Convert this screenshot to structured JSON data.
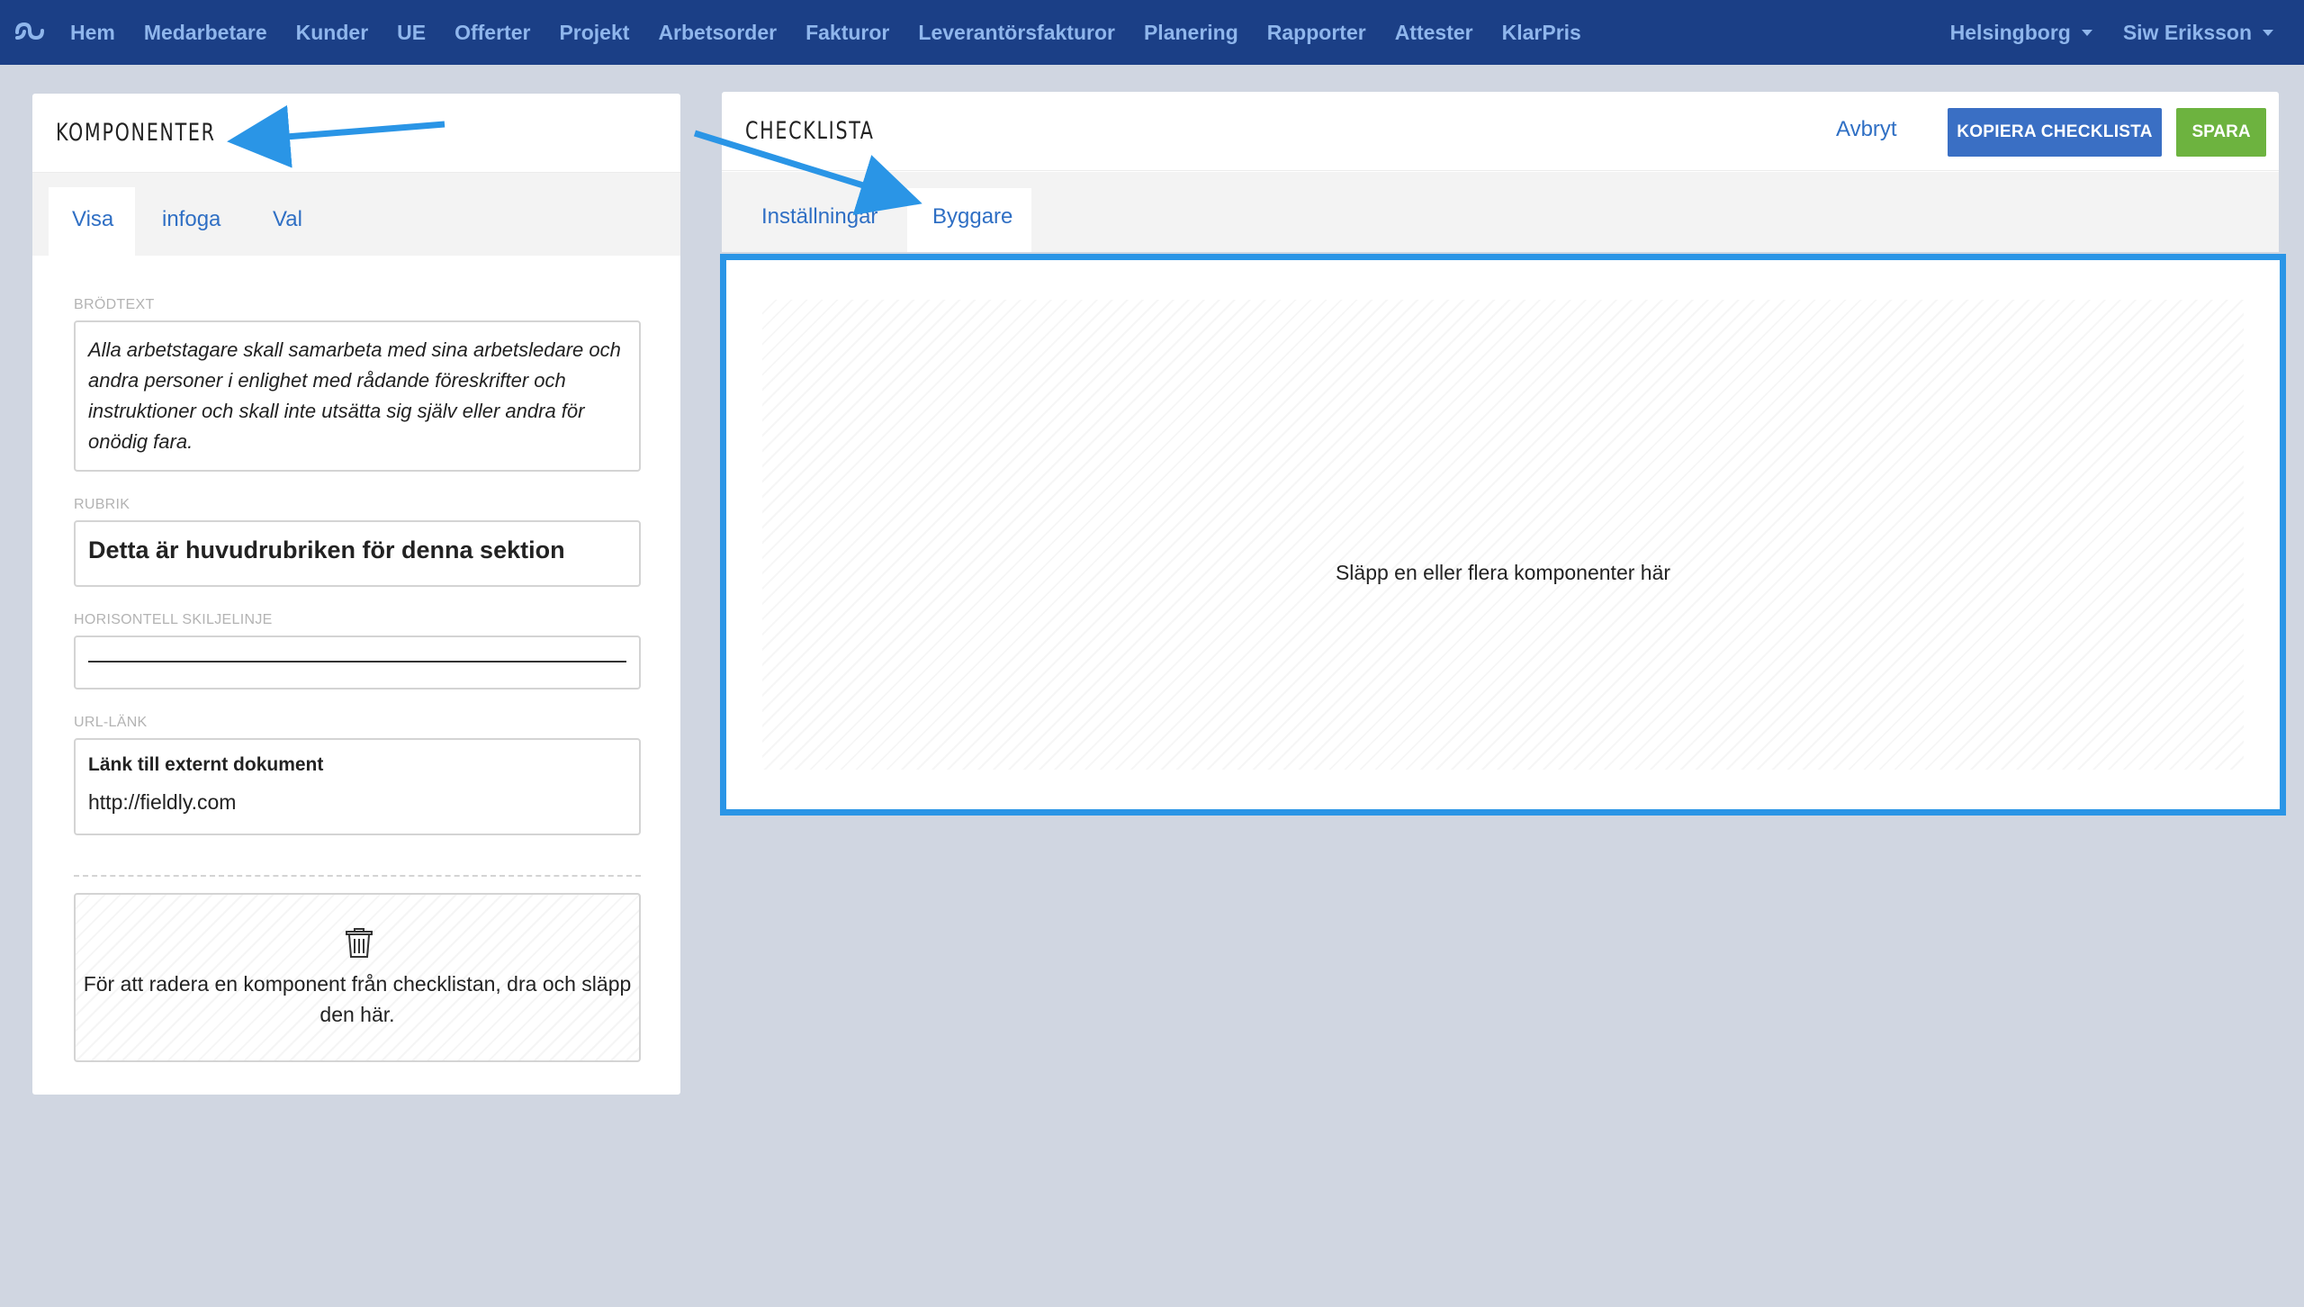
{
  "nav": {
    "items": [
      "Hem",
      "Medarbetare",
      "Kunder",
      "UE",
      "Offerter",
      "Projekt",
      "Arbetsorder",
      "Fakturor",
      "Leverantörsfakturor",
      "Planering",
      "Rapporter",
      "Attester",
      "KlarPris"
    ],
    "location": "Helsingborg",
    "user": "Siw Eriksson"
  },
  "components_panel": {
    "title": "KOMPONENTER",
    "tabs": [
      "Visa",
      "infoga",
      "Val"
    ],
    "active_tab": "Visa",
    "fields": {
      "body_label": "BRÖDTEXT",
      "body_text": "Alla arbetstagare skall samarbeta med sina arbetsledare och andra personer i enlighet med rådande föreskrifter och instruktioner och skall inte utsätta sig själv eller andra för onödig fara.",
      "heading_label": "RUBRIK",
      "heading_text": "Detta är huvudrubriken för denna sektion",
      "divider_label": "HORISONTELL SKILJELINJE",
      "url_label": "URL-LÄNK",
      "url_title": "Länk till externt dokument",
      "url_value": "http://fieldly.com"
    },
    "trash_text": "För att radera en komponent från checklistan, dra och släpp den här."
  },
  "checklist_panel": {
    "title": "CHECKLISTA",
    "cancel_label": "Avbryt",
    "copy_label": "KOPIERA CHECKLISTA",
    "save_label": "SPARA",
    "tabs": [
      "Inställningar",
      "Byggare"
    ],
    "active_tab": "Byggare",
    "drop_text": "Släpp en eller flera komponenter här"
  },
  "colors": {
    "nav_bg": "#1b3f86",
    "nav_text": "#8fb6ec",
    "accent_blue": "#3a6fc4",
    "save_green": "#6db33f",
    "annotation_blue": "#2a95e6"
  },
  "icons": {
    "logo": "fieldly-logo-icon",
    "trash": "trash-icon",
    "caret": "caret-down-icon"
  }
}
